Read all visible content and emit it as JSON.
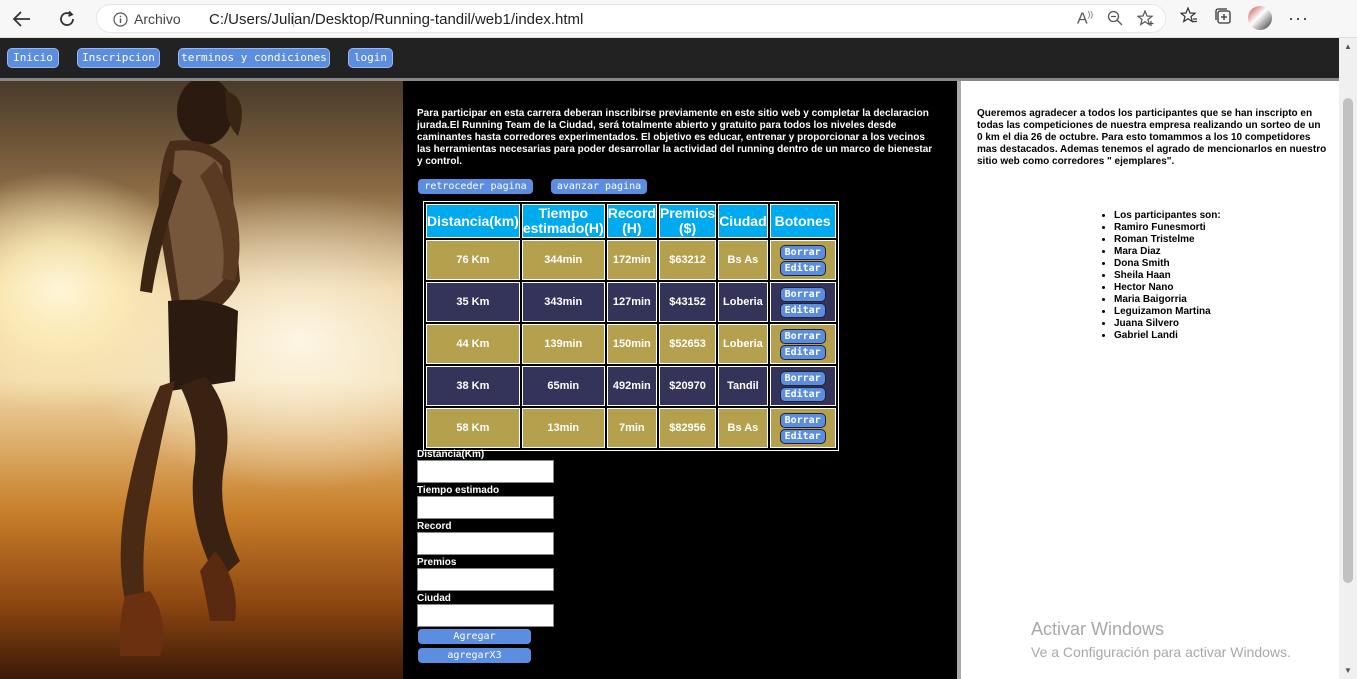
{
  "browser": {
    "protocol_label": "Archivo",
    "url": "C:/Users/Julian/Desktop/Running-tandil/web1/index.html"
  },
  "nav": {
    "items": [
      "Inicio",
      "Inscripcion",
      "terminos y condiciones",
      "login"
    ]
  },
  "intro_text": "Para participar en esta carrera deberan inscribirse previamente en este sitio web y completar la declaracion jurada.El Running Team de la Ciudad, será totalmente abierto y gratuito para todos los niveles desde caminantes hasta corredores experimentados. El objetivo es educar, entrenar y proporcionar a los vecinos las herramientas necesarias para poder desarrollar la actividad del running dentro de un marco de bienestar y control.",
  "paging": {
    "prev_label": "retroceder pagina",
    "next_label": "avanzar pagina"
  },
  "table": {
    "headers": [
      "Distancia(km)",
      "Tiempo estimado(H)",
      "Record (H)",
      "Premios ($)",
      "Ciudad",
      "Botones"
    ],
    "rows": [
      {
        "distancia": "76 Km",
        "tiempo": "344min",
        "record": "172min",
        "premio": "$63212",
        "ciudad": "Bs As"
      },
      {
        "distancia": "35 Km",
        "tiempo": "343min",
        "record": "127min",
        "premio": "$43152",
        "ciudad": "Loberia"
      },
      {
        "distancia": "44 Km",
        "tiempo": "139min",
        "record": "150min",
        "premio": "$52653",
        "ciudad": "Loberia"
      },
      {
        "distancia": "38 Km",
        "tiempo": "65min",
        "record": "492min",
        "premio": "$20970",
        "ciudad": "Tandil"
      },
      {
        "distancia": "58 Km",
        "tiempo": "13min",
        "record": "7min",
        "premio": "$82956",
        "ciudad": "Bs As"
      }
    ],
    "delete_label": "Borrar",
    "edit_label": "Editar"
  },
  "form": {
    "labels": [
      "Distancia(Km)",
      "Tiempo estimado",
      "Record",
      "Premios",
      "Ciudad"
    ],
    "add_label": "Agregar",
    "add3_label": "agregarX3"
  },
  "thanks_text": "Queremos agradecer a todos los participantes que se han inscripto en todas las competiciones de nuestra empresa realizando un sorteo de un 0 km el dia 26 de octubre. Para esto tomammos a los 10 competidores mas destacados. Ademas tenemos el agrado de mencionarlos en nuestro sitio web como corredores \" ejemplares\".",
  "participants": [
    "Los participantes son:",
    "Ramiro Funesmorti",
    "Roman Tristelme",
    "Mara Diaz",
    "Dona Smith",
    "Sheila Haan",
    "Hector Nano",
    "Maria Baigorria",
    "Leguizamon Martina",
    "Juana Silvero",
    "Gabriel Landi"
  ],
  "watermark": {
    "title": "Activar Windows",
    "subtitle": "Ve a Configuración para activar Windows."
  }
}
